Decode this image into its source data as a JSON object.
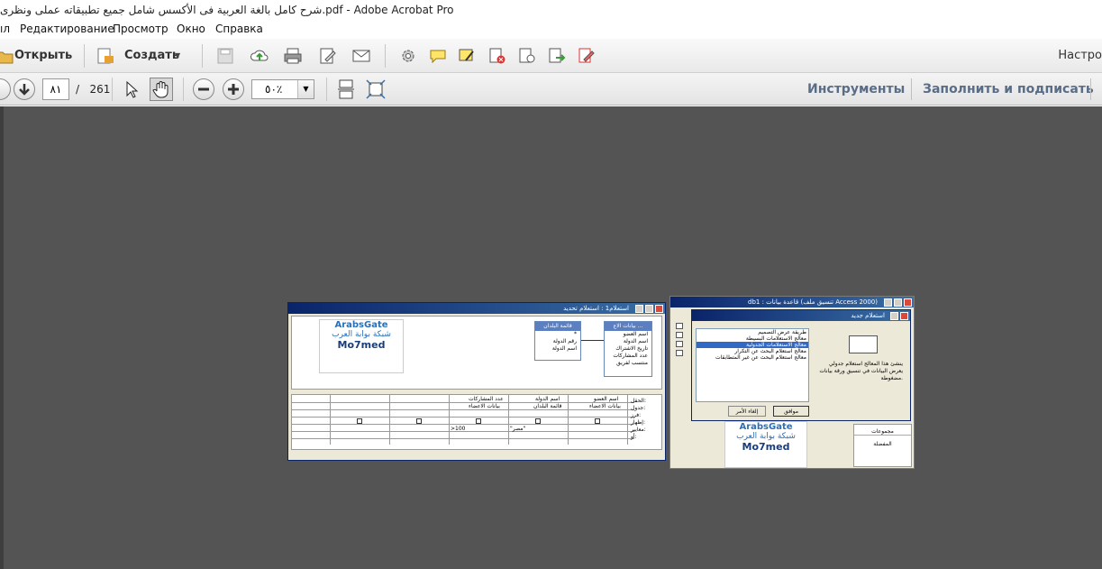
{
  "window": {
    "title": "شرح كامل بالغة العربية فى الأكسس  شامل جميع تطبيقاته عملى ونظرى.pdf - Adobe Acrobat Pro"
  },
  "menu": {
    "items": [
      "ıл",
      "Редактирование",
      "Просмотр",
      "Окно",
      "Справка"
    ]
  },
  "toolbar": {
    "open_label": "Открыть",
    "create_label": "Создать",
    "customize_label": "Настро"
  },
  "navigation": {
    "current_page": "٨١",
    "separator": "/",
    "total_pages": "261",
    "zoom_value": "٥٠٪",
    "tools_label": "Инструменты",
    "fill_sign_label": "Заполнить и подписать"
  },
  "document": {
    "query_window": {
      "title": "استعلام1 : استعلام تحديد",
      "table1_title": "قائمة البلدان",
      "table1_fields": [
        "*",
        "رقم الدولة",
        "اسم الدولة"
      ],
      "table2_title": "بيانات الاع ...",
      "table2_fields": [
        "اسم العضو",
        "اسم الدولة",
        "تاريخ الاشتراك",
        "عدد المشاركات",
        "منتسب لفريق"
      ],
      "grid_labels": [
        "الحقل:",
        "جدول:",
        "فرز:",
        "إظهار:",
        "معايير:",
        "أو:"
      ],
      "grid_cols": [
        {
          "field": "اسم العضو",
          "table": "بيانات الاعضاء"
        },
        {
          "field": "اسم الدولة",
          "table": "قائمة البلدان"
        },
        {
          "field": "عدد المشاركات",
          "table": "بيانات الاعضاء"
        }
      ],
      "criteria": [
        ">100",
        "\"مصر\""
      ]
    },
    "db_window": {
      "title": "db1 : قاعدة بيانات (تنسيق ملف Access 2000)",
      "dialog_title": "استعلام جديد",
      "options": [
        "طريقة عرض التصميم",
        "معالج الاستعلامات البسيطة",
        "معالج الاستعلامات الجدولية",
        "معالج استعلام البحث عن التكرار",
        "معالج استعلام البحث عن غير المتطابقات"
      ],
      "description": "ينشئ هذا المعالج استعلام جدولي يعرض البيانات في تنسيق ورقة بيانات مضغوطة.",
      "ok_label": "موافق",
      "cancel_label": "إلغاء الأمر",
      "groups_label": "مجموعات",
      "favorites_label": "المفضلة"
    },
    "logo": {
      "brand": "ArabsGate",
      "tagline": "شبكة بوابة العرب",
      "author": "Mo7med"
    }
  }
}
